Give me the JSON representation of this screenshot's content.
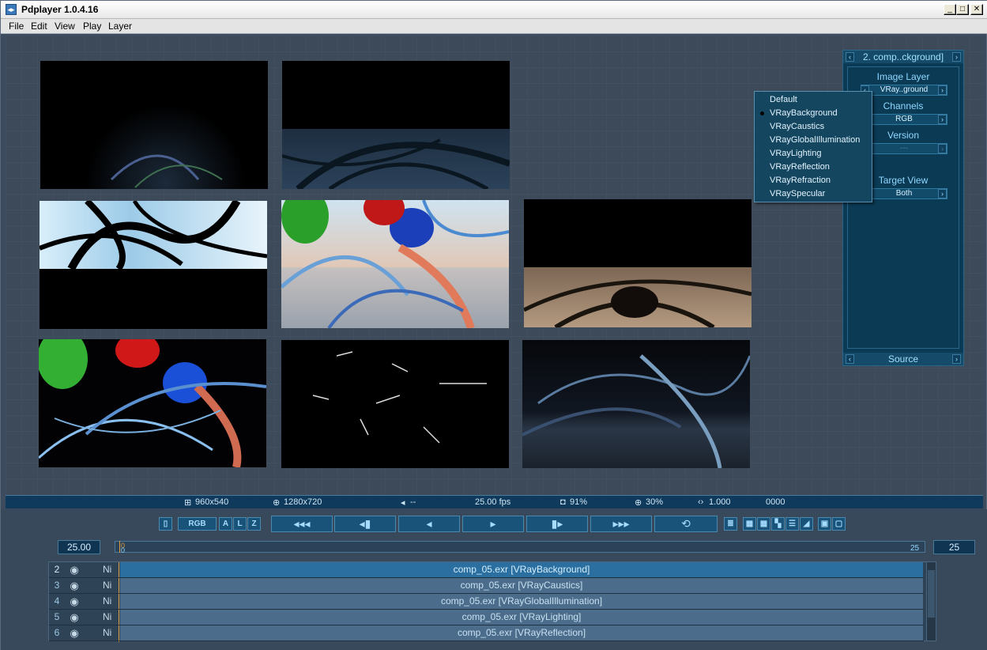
{
  "window": {
    "title": "Pdplayer 1.0.4.16",
    "minimize": "_",
    "maximize": "□",
    "close": "✕"
  },
  "menu": [
    "File",
    "Edit",
    "View",
    "Play",
    "Layer"
  ],
  "panel": {
    "header": "2. comp..ckground]",
    "image_layer_label": "Image Layer",
    "image_layer_value": "VRay..ground",
    "channels_label": "Channels",
    "channels_value": "RGB",
    "version_label": "Version",
    "version_value": "---",
    "target_view_label": "Target View",
    "target_view_value": "Both",
    "footer": "Source"
  },
  "dropdown": {
    "options": [
      "Default",
      "VRayBackground",
      "VRayCaustics",
      "VRayGlobalIllumination",
      "VRayLighting",
      "VRayReflection",
      "VRayRefraction",
      "VRaySpecular"
    ],
    "selected": "VRayBackground"
  },
  "status": {
    "source_res": "960x540",
    "output_res": "1280x720",
    "audio": "--",
    "fps": "25.00 fps",
    "opacity": "91%",
    "zoom": "30%",
    "gamma": "1.000",
    "frame": "0000"
  },
  "transport": {
    "channel_buttons": [
      "RGB",
      "A",
      "L",
      "Z"
    ],
    "start_value": "25.00",
    "end_value": "25",
    "timeline_start_label": "0",
    "timeline_end_label": "25",
    "timeline_current_label": "0"
  },
  "layers": [
    {
      "num": "2",
      "flag": "Ni",
      "name": "comp_05.exr [VRayBackground]",
      "selected": true
    },
    {
      "num": "3",
      "flag": "Ni",
      "name": "comp_05.exr [VRayCaustics]",
      "selected": false
    },
    {
      "num": "4",
      "flag": "Ni",
      "name": "comp_05.exr [VRayGlobalIllumination]",
      "selected": false
    },
    {
      "num": "5",
      "flag": "Ni",
      "name": "comp_05.exr [VRayLighting]",
      "selected": false
    },
    {
      "num": "6",
      "flag": "Ni",
      "name": "comp_05.exr [VRayReflection]",
      "selected": false
    }
  ],
  "colors": {
    "accent": "#8fd8ff",
    "panel": "#0b3a55",
    "selected_row": "#2a6fa0"
  }
}
